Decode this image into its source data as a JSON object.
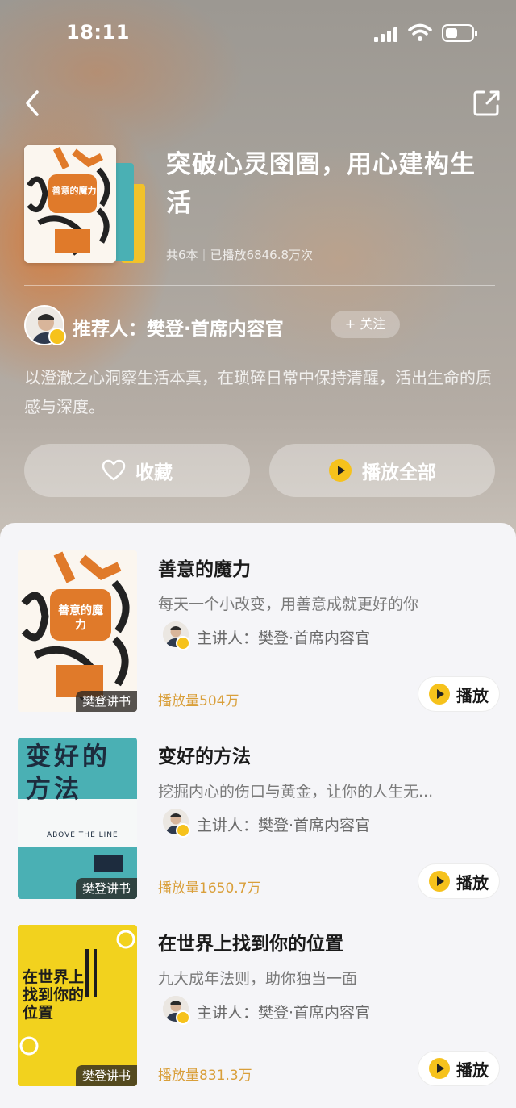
{
  "status_bar": {
    "time": "18:11"
  },
  "collection": {
    "title": "突破心灵囹圄，用心建构生活",
    "stats": "共6本｜已播放6846.8万次",
    "cover_title": "善意的魔力",
    "recommender": {
      "label": "推荐人：樊登·首席内容官",
      "follow_label": "+ 关注"
    },
    "description": "以澄澈之心洞察生活本真，在琐碎日常中保持清醒，活出生命的质感与深度。",
    "buttons": {
      "favorite": "收藏",
      "play_all": "播放全部"
    }
  },
  "books": [
    {
      "title": "善意的魔力",
      "description": "每天一个小改变，用善意成就更好的你",
      "speaker": "主讲人：樊登·首席内容官",
      "play_count": "播放量504万",
      "play_label": "播放",
      "tag": "樊登讲书",
      "cover_text": "善意的魔力"
    },
    {
      "title": "变好的方法",
      "description": "挖掘内心的伤口与黄金，让你的人生无...",
      "speaker": "主讲人：樊登·首席内容官",
      "play_count": "播放量1650.7万",
      "play_label": "播放",
      "tag": "樊登讲书",
      "cover_text": "变好的方法",
      "cover_subtext": "ABOVE THE LINE"
    },
    {
      "title": "在世界上找到你的位置",
      "description": "九大成年法则，助你独当一面",
      "speaker": "主讲人：樊登·首席内容官",
      "play_count": "播放量831.3万",
      "play_label": "播放",
      "tag": "樊登讲书",
      "cover_text": "在世界上找到你的位置"
    }
  ],
  "colors": {
    "accent": "#f6c21c",
    "play_count": "#d99f3a",
    "cover_orange": "#e07a2a",
    "cover_teal": "#4ab0b4",
    "cover_yellow": "#f2d21e"
  },
  "icons": [
    "back-icon",
    "share-icon",
    "heart-icon",
    "play-icon",
    "verified-badge-icon",
    "signal-icon",
    "wifi-icon",
    "battery-icon"
  ]
}
